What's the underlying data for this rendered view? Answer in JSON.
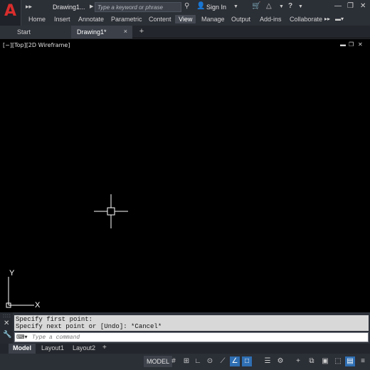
{
  "app": {
    "logo_letter": "A",
    "quick_access": "▸▸",
    "document_title": "Drawing1...",
    "search_placeholder": "Type a keyword or phrase",
    "sign_in": "Sign In"
  },
  "ribbon": {
    "tabs": [
      {
        "label": "Home"
      },
      {
        "label": "Insert"
      },
      {
        "label": "Annotate"
      },
      {
        "label": "Parametric"
      },
      {
        "label": "Content"
      },
      {
        "label": "View",
        "active": true
      },
      {
        "label": "Manage"
      },
      {
        "label": "Output"
      },
      {
        "label": "Add-ins"
      },
      {
        "label": "Collaborate"
      }
    ]
  },
  "file_tabs": {
    "start": "Start",
    "drawing": "Drawing1*",
    "close": "×",
    "add": "+"
  },
  "viewport": {
    "label": "[−][Top][2D Wireframe]",
    "ucs_y": "Y",
    "ucs_x": "X"
  },
  "command": {
    "history": [
      "Specify first point:",
      "Specify next point or [Undo]: *Cancel*"
    ],
    "placeholder": "Type a command"
  },
  "layout_tabs": {
    "tabs": [
      {
        "label": "Model",
        "active": true
      },
      {
        "label": "Layout1"
      },
      {
        "label": "Layout2"
      }
    ],
    "add": "+"
  },
  "status_bar": {
    "model_label": "MODEL"
  },
  "colors": {
    "accent": "#2f6fb3",
    "logo_red": "#d92d2d",
    "canvas": "#000000"
  },
  "icons": [
    "app-logo-icon",
    "share-icon",
    "user-icon",
    "cart-icon",
    "triangle-icon",
    "help-icon",
    "minimize-icon",
    "restore-icon",
    "close-icon",
    "grid-icon",
    "snap-icon",
    "ortho-icon",
    "polar-icon",
    "osnap-icon",
    "lineweight-icon",
    "gear-icon",
    "plus-icon",
    "hardware-icon"
  ]
}
